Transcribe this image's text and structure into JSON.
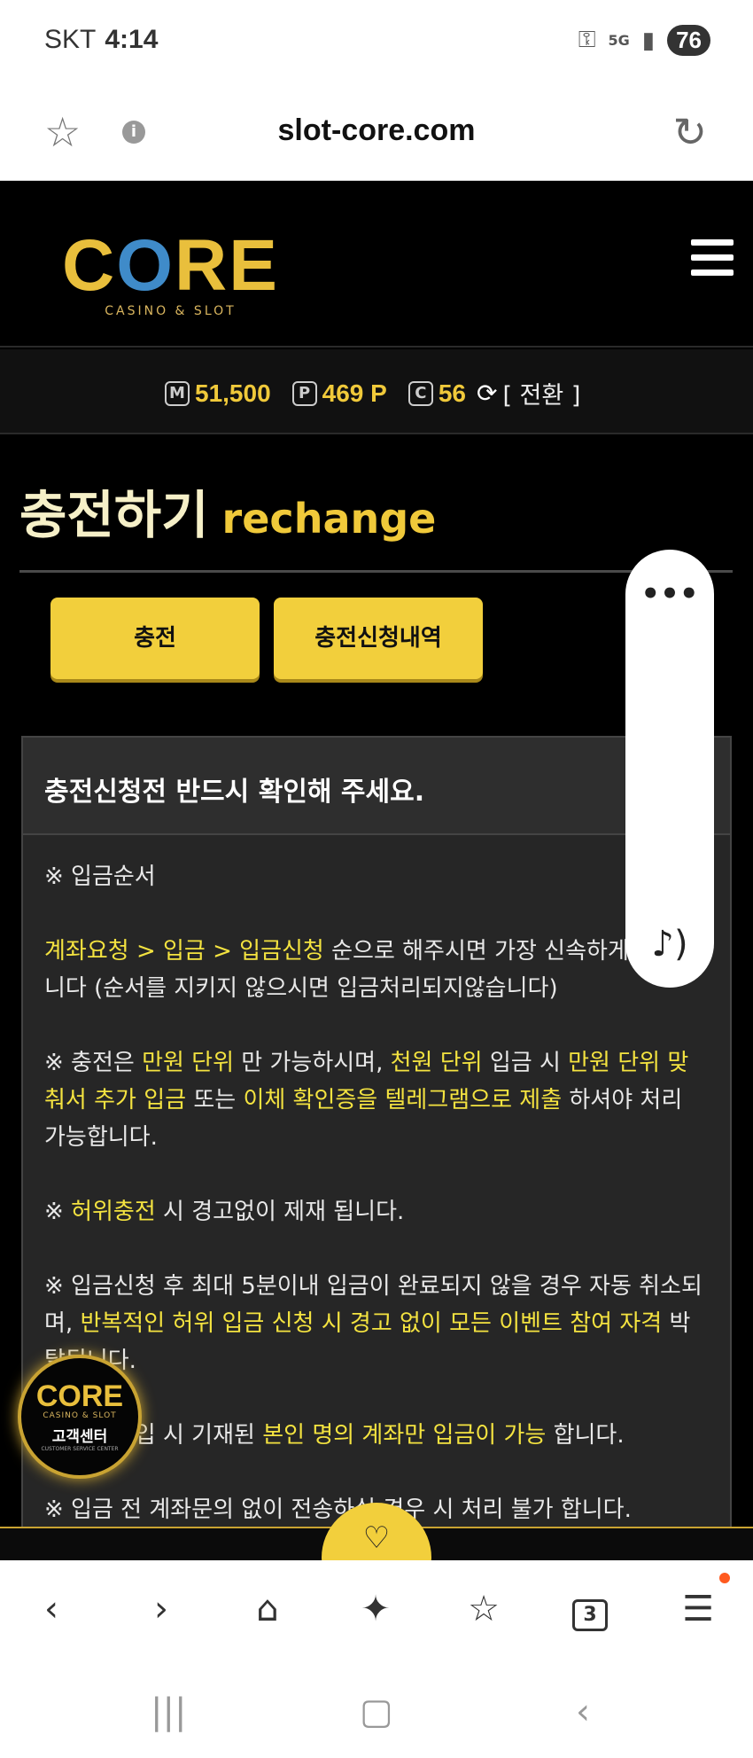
{
  "status_bar": {
    "carrier": "SKT",
    "time": "4:14",
    "network": "5G",
    "battery": "76"
  },
  "browser": {
    "url": "slot-core.com"
  },
  "site": {
    "logo_main_1": "C",
    "logo_main_2": "O",
    "logo_main_3": "RE",
    "logo_sub": "CASINO & SLOT",
    "balance": {
      "money_badge": "M",
      "money": "51,500",
      "point_badge": "P",
      "point": "469 P",
      "coin_badge": "C",
      "coin": "56",
      "swap_label": "[ 전환 ]"
    },
    "page_title_ko": "충전하기",
    "page_title_en": "rechange",
    "buttons": {
      "charge": "충전",
      "history": "충전신청내역"
    }
  },
  "notice": {
    "heading": "충전신청전 반드시 확인해 주세요.",
    "s1_title": "※ 입금순서",
    "s1_hl": "계좌요청 > 입금 > 입금신청",
    "s1_rest": " 순으로 해주시면 가장 신속하게 처리됩니다 (순서를 지키지 않으시면 입금처리되지않습니다)",
    "s2_a": "※ 충전은 ",
    "s2_hl1": "만원 단위",
    "s2_b": " 만 가능하시며, ",
    "s2_hl2": "천원 단위",
    "s2_c": " 입금 시 ",
    "s2_hl3": "만원 단위 맞춰서 추가 입금",
    "s2_d": " 또는 ",
    "s2_hl4": "이체 확인증을 텔레그램으로 제출",
    "s2_e": " 하셔야 처리 가능합니다.",
    "s3_a": "※ ",
    "s3_hl": "허위충전",
    "s3_b": " 시 경고없이 제재 됩니다.",
    "s4_a": "※ 입금신청 후 최대 5분이내 입금이 완료되지 않을 경우 자동 취소되며, ",
    "s4_hl": "반복적인 허위 입금 신청 시 경고 없이 모든 이벤트 참여 자격",
    "s4_b": " 박탈됩니다.",
    "s5_a": "※ 회원가입 시 기재된 ",
    "s5_hl": "본인 명의 계좌만 입금이 가능",
    "s5_b": " 합니다.",
    "s6": "※ 입금 전 계좌문의 없이 전송하실 경우 시 처리 불가 합니다."
  },
  "customer_center": {
    "logo": "CORE",
    "sub": "CASINO & SLOT",
    "title": "고객센터",
    "tiny": "CUSTOMER SERVICE CENTER"
  },
  "toolbar": {
    "tabs_count": "3"
  },
  "icons": {
    "back": "chevron-left",
    "forward": "chevron-right",
    "home": "house",
    "ai": "sparkle",
    "bookmarks": "star-list",
    "tabs": "tabs",
    "menu": "hamburger"
  },
  "colors": {
    "accent": "#f2cf3c",
    "highlight": "#f4e340",
    "background": "#000000"
  }
}
